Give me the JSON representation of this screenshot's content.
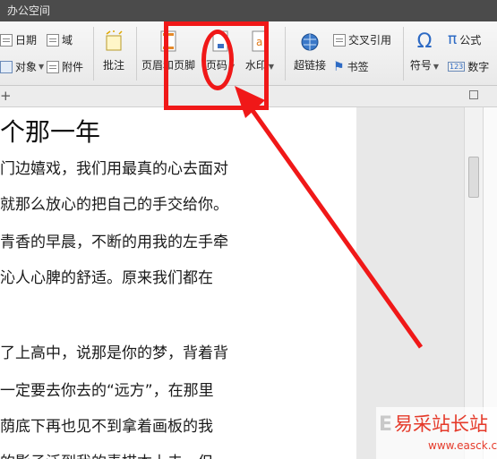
{
  "titlebar": {
    "title": "办公空间"
  },
  "ribbon": {
    "date_label": "日期",
    "field_label": "域",
    "object_label": "对象",
    "attachment_label": "附件",
    "comment_label": "批注",
    "header_footer_label": "页眉和页脚",
    "page_number_label": "页码",
    "watermark_label": "水印",
    "hyperlink_label": "超链接",
    "cross_ref_label": "交叉引用",
    "bookmark_label": "书签",
    "symbol_label": "符号",
    "formula_label": "公式",
    "number_label": "数字"
  },
  "document": {
    "title": "个那一年",
    "lines": [
      "门边嬉戏，我们用最真的心去面对",
      "就那么放心的把自己的手交给你。",
      "青香的早晨，不断的用我的左手牵",
      "沁人心脾的舒适。原来我们都在",
      "了上高中，说那是你的梦，背着背",
      "一定要去你去的“远方”，在那里",
      "荫底下再也见不到拿着画板的我",
      "的影子泛到我的素描本上去，但"
    ]
  },
  "watermark": {
    "main": "易采站长站",
    "url": "www.easck.com",
    "e": "E"
  },
  "colors": {
    "annotation_red": "#f01818",
    "titlebar": "#4b4b4b"
  }
}
